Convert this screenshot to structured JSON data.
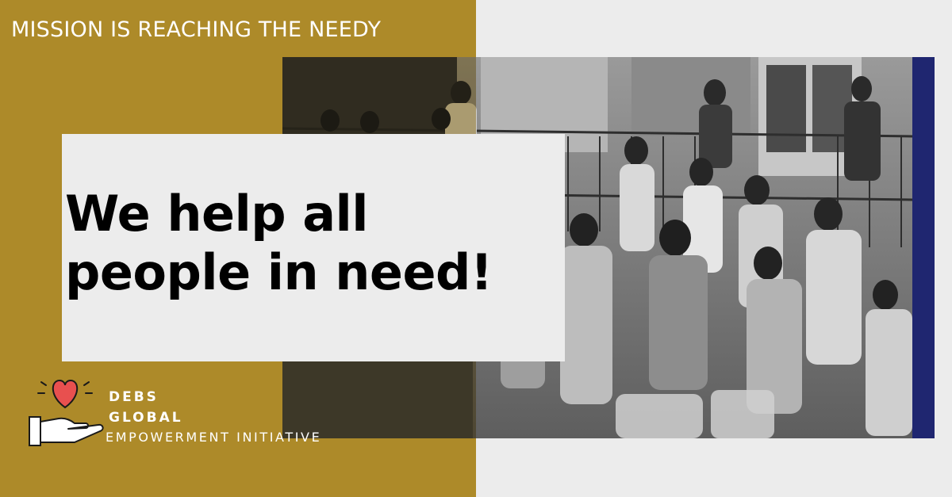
{
  "banner": {
    "mission": "MISSION IS REACHING THE NEEDY",
    "headline_line1": "We help all",
    "headline_line2": "people in need!"
  },
  "brand": {
    "line1": "DEBS",
    "line2": "GLOBAL",
    "line3": "EMPOWERMENT INITIATIVE"
  },
  "colors": {
    "gold": "#ad8a29",
    "light_gray": "#ececec",
    "navy": "#1f2670",
    "heart": "#e8504f"
  },
  "icons": {
    "logo": "heart-in-hand-icon"
  }
}
